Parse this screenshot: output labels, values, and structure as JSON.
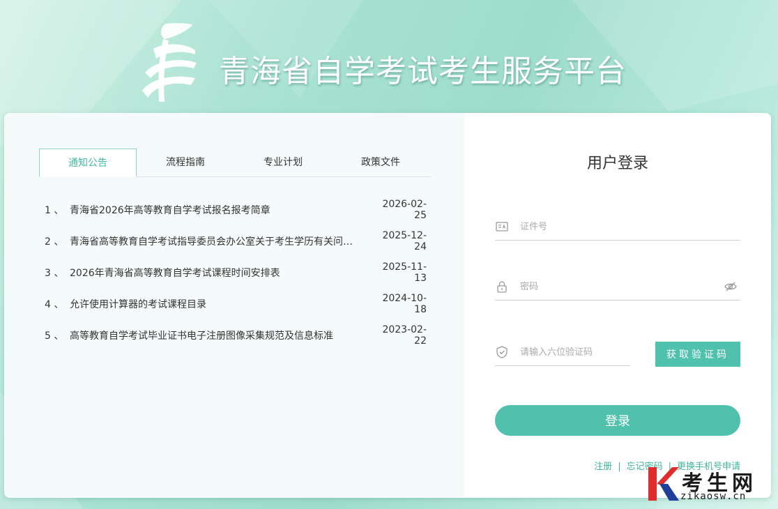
{
  "header": {
    "title": "青海省自学考试考生服务平台"
  },
  "tabs": [
    {
      "label": "通知公告",
      "active": true
    },
    {
      "label": "流程指南",
      "active": false
    },
    {
      "label": "专业计划",
      "active": false
    },
    {
      "label": "政策文件",
      "active": false
    }
  ],
  "news": [
    {
      "num": "1 、",
      "title": "青海省2026年高等教育自学考试报名报考简章",
      "date": "2026-02-25"
    },
    {
      "num": "2 、",
      "title": "青海省高等教育自学考试指导委员会办公室关于考生学历有关问题的通知",
      "date": "2025-12-24"
    },
    {
      "num": "3 、",
      "title": "2026年青海省高等教育自学考试课程时间安排表",
      "date": "2025-11-13"
    },
    {
      "num": "4 、",
      "title": "允许使用计算器的考试课程目录",
      "date": "2024-10-18"
    },
    {
      "num": "5 、",
      "title": "高等教育自学考试毕业证书电子注册图像采集规范及信息标准",
      "date": "2023-02-22"
    }
  ],
  "login": {
    "title": "用户登录",
    "id_placeholder": "证件号",
    "password_placeholder": "密码",
    "code_placeholder": "请输入六位验证码",
    "get_code_label": "获取验证码",
    "submit_label": "登录",
    "links": {
      "register": "注册",
      "forgot": "忘记密码",
      "change_phone": "更换手机号申请",
      "separator": "|"
    }
  },
  "watermark": {
    "big": "考生网",
    "small": "zikaosw.cn"
  },
  "colors": {
    "accent": "#4fc1ad",
    "link": "#3eb39c",
    "background": "#a9e2d2"
  },
  "icons": [
    "logo-icon",
    "id-card-icon",
    "lock-icon",
    "eye-hidden-icon",
    "shield-icon",
    "watermark-k-icon"
  ]
}
